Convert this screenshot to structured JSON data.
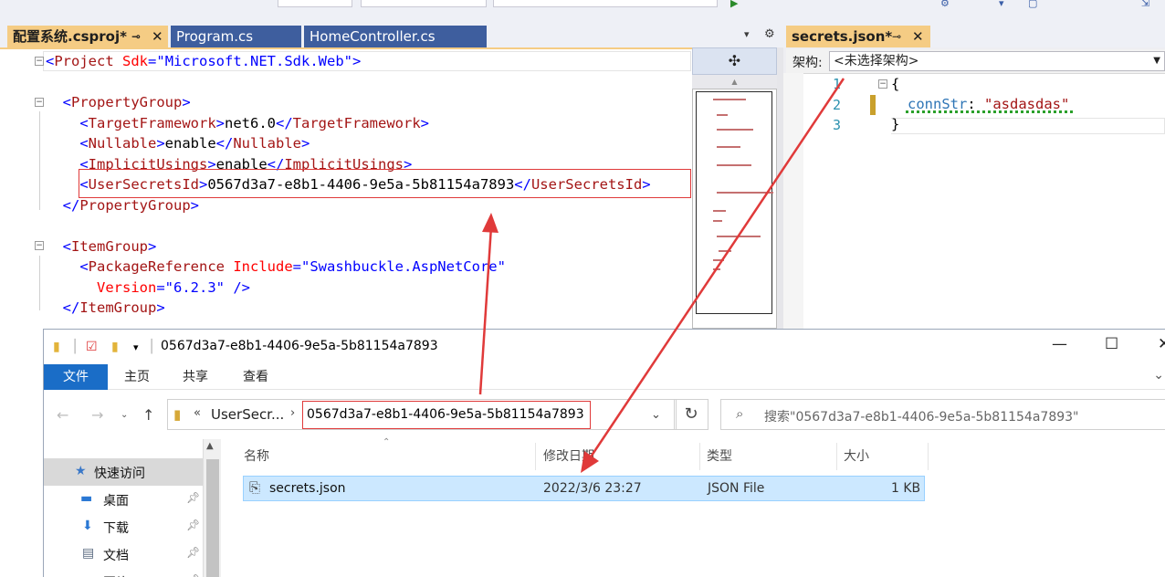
{
  "toolbar": {},
  "tabs": [
    {
      "label": "配置系统.csproj*",
      "active": true
    },
    {
      "label": "Program.cs",
      "active": false
    },
    {
      "label": "HomeController.cs",
      "active": false
    }
  ],
  "csproj_code": {
    "line1": {
      "open": "<",
      "tag": "Project",
      "attr": "Sdk",
      "eq": "=",
      "val": "\"Microsoft.NET.Sdk.Web\"",
      "close": ">"
    },
    "pg_open": "PropertyGroup",
    "target_framework": {
      "tag": "TargetFramework",
      "value": "net6.0"
    },
    "nullable": {
      "tag": "Nullable",
      "value": "enable"
    },
    "implicit_usings": {
      "tag": "ImplicitUsings",
      "value": "enable"
    },
    "user_secrets_id": {
      "tag": "UserSecretsId",
      "value": "0567d3a7-e8b1-4406-9e5a-5b81154a7893"
    },
    "pg_close": "PropertyGroup",
    "ig_open": "ItemGroup",
    "package_ref": {
      "tag": "PackageReference",
      "attr1": "Include",
      "val1": "\"Swashbuckle.AspNetCore\"",
      "attr2": "Version",
      "val2": "\"6.2.3\"",
      "end": " />"
    },
    "ig_close": "ItemGroup"
  },
  "right_pane": {
    "tab_label": "secrets.json*",
    "arch_label": "架构:",
    "arch_value": "<未选择架构>",
    "line_numbers": [
      "1",
      "2",
      "3"
    ],
    "json_open": "{",
    "json_key": "connStr",
    "json_colon": ": ",
    "json_value": "\"asdasdas\"",
    "json_close": "}"
  },
  "explorer": {
    "title": "0567d3a7-e8b1-4406-9e5a-5b81154a7893",
    "ribbon": {
      "file": "文件",
      "home": "主页",
      "share": "共享",
      "view": "查看"
    },
    "address": {
      "chevrons": "«",
      "parent": "UserSecr...",
      "current": "0567d3a7-e8b1-4406-9e5a-5b81154a7893"
    },
    "search_placeholder": "搜索\"0567d3a7-e8b1-4406-9e5a-5b81154a7893\"",
    "nav": [
      {
        "label": "快速访问",
        "icon": "star-icon"
      },
      {
        "label": "桌面",
        "icon": "desktop-icon"
      },
      {
        "label": "下载",
        "icon": "download-icon"
      },
      {
        "label": "文档",
        "icon": "document-icon"
      },
      {
        "label": "图片",
        "icon": "picture-icon"
      }
    ],
    "columns": {
      "name": "名称",
      "modified": "修改日期",
      "type": "类型",
      "size": "大小"
    },
    "files": [
      {
        "name": "secrets.json",
        "modified": "2022/3/6 23:27",
        "type": "JSON File",
        "size": "1 KB"
      }
    ]
  },
  "colors": {
    "accent_tab": "#f5cc84",
    "inactive_tab": "#3e5e9e",
    "annotation_red": "#e03a3a",
    "selected_row": "#cce8ff"
  }
}
